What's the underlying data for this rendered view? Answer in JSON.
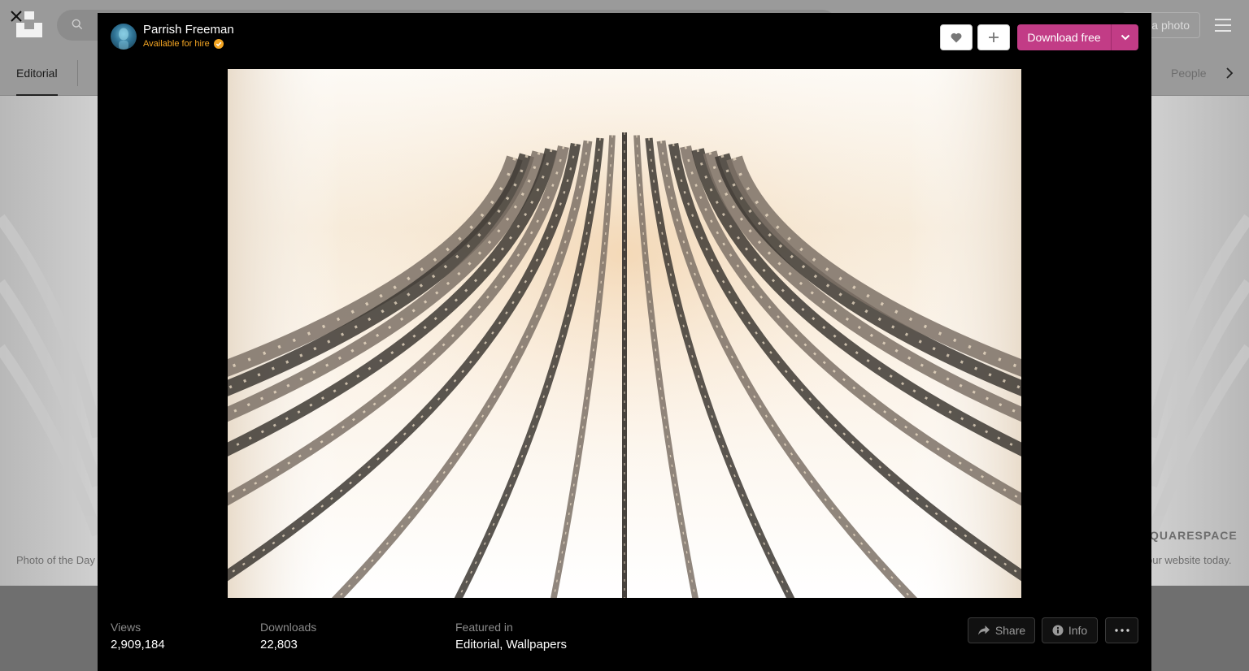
{
  "background": {
    "header": {
      "submit_label": "a photo"
    },
    "nav": {
      "active_label": "Editorial",
      "trailing_label": "People"
    },
    "hero": {
      "caption": "Photo of the Day",
      "sponsor_name": "QUARESPACE",
      "sponsor_tagline": "our website today."
    }
  },
  "modal": {
    "author": {
      "name": "Parrish Freeman",
      "hire_label": "Available for hire"
    },
    "actions": {
      "download_label": "Download free"
    },
    "stats": {
      "views_label": "Views",
      "views_value": "2,909,184",
      "downloads_label": "Downloads",
      "downloads_value": "22,803",
      "featured_label": "Featured in",
      "featured_items": [
        "Editorial",
        "Wallpapers"
      ],
      "featured_separator": ", "
    },
    "footer_actions": {
      "share_label": "Share",
      "info_label": "Info"
    }
  },
  "icons": {
    "close": "close-icon",
    "search": "search-icon",
    "menu": "menu-icon",
    "chevron_right": "chevron-right-icon",
    "heart": "heart-icon",
    "plus": "plus-icon",
    "chevron_down": "chevron-down-icon",
    "verified": "verified-badge-icon",
    "share": "share-icon",
    "info": "info-icon",
    "more": "more-icon"
  },
  "colors": {
    "download_accent": "#c23c86",
    "hire_accent": "#f5a623",
    "modal_bg": "#000000"
  }
}
